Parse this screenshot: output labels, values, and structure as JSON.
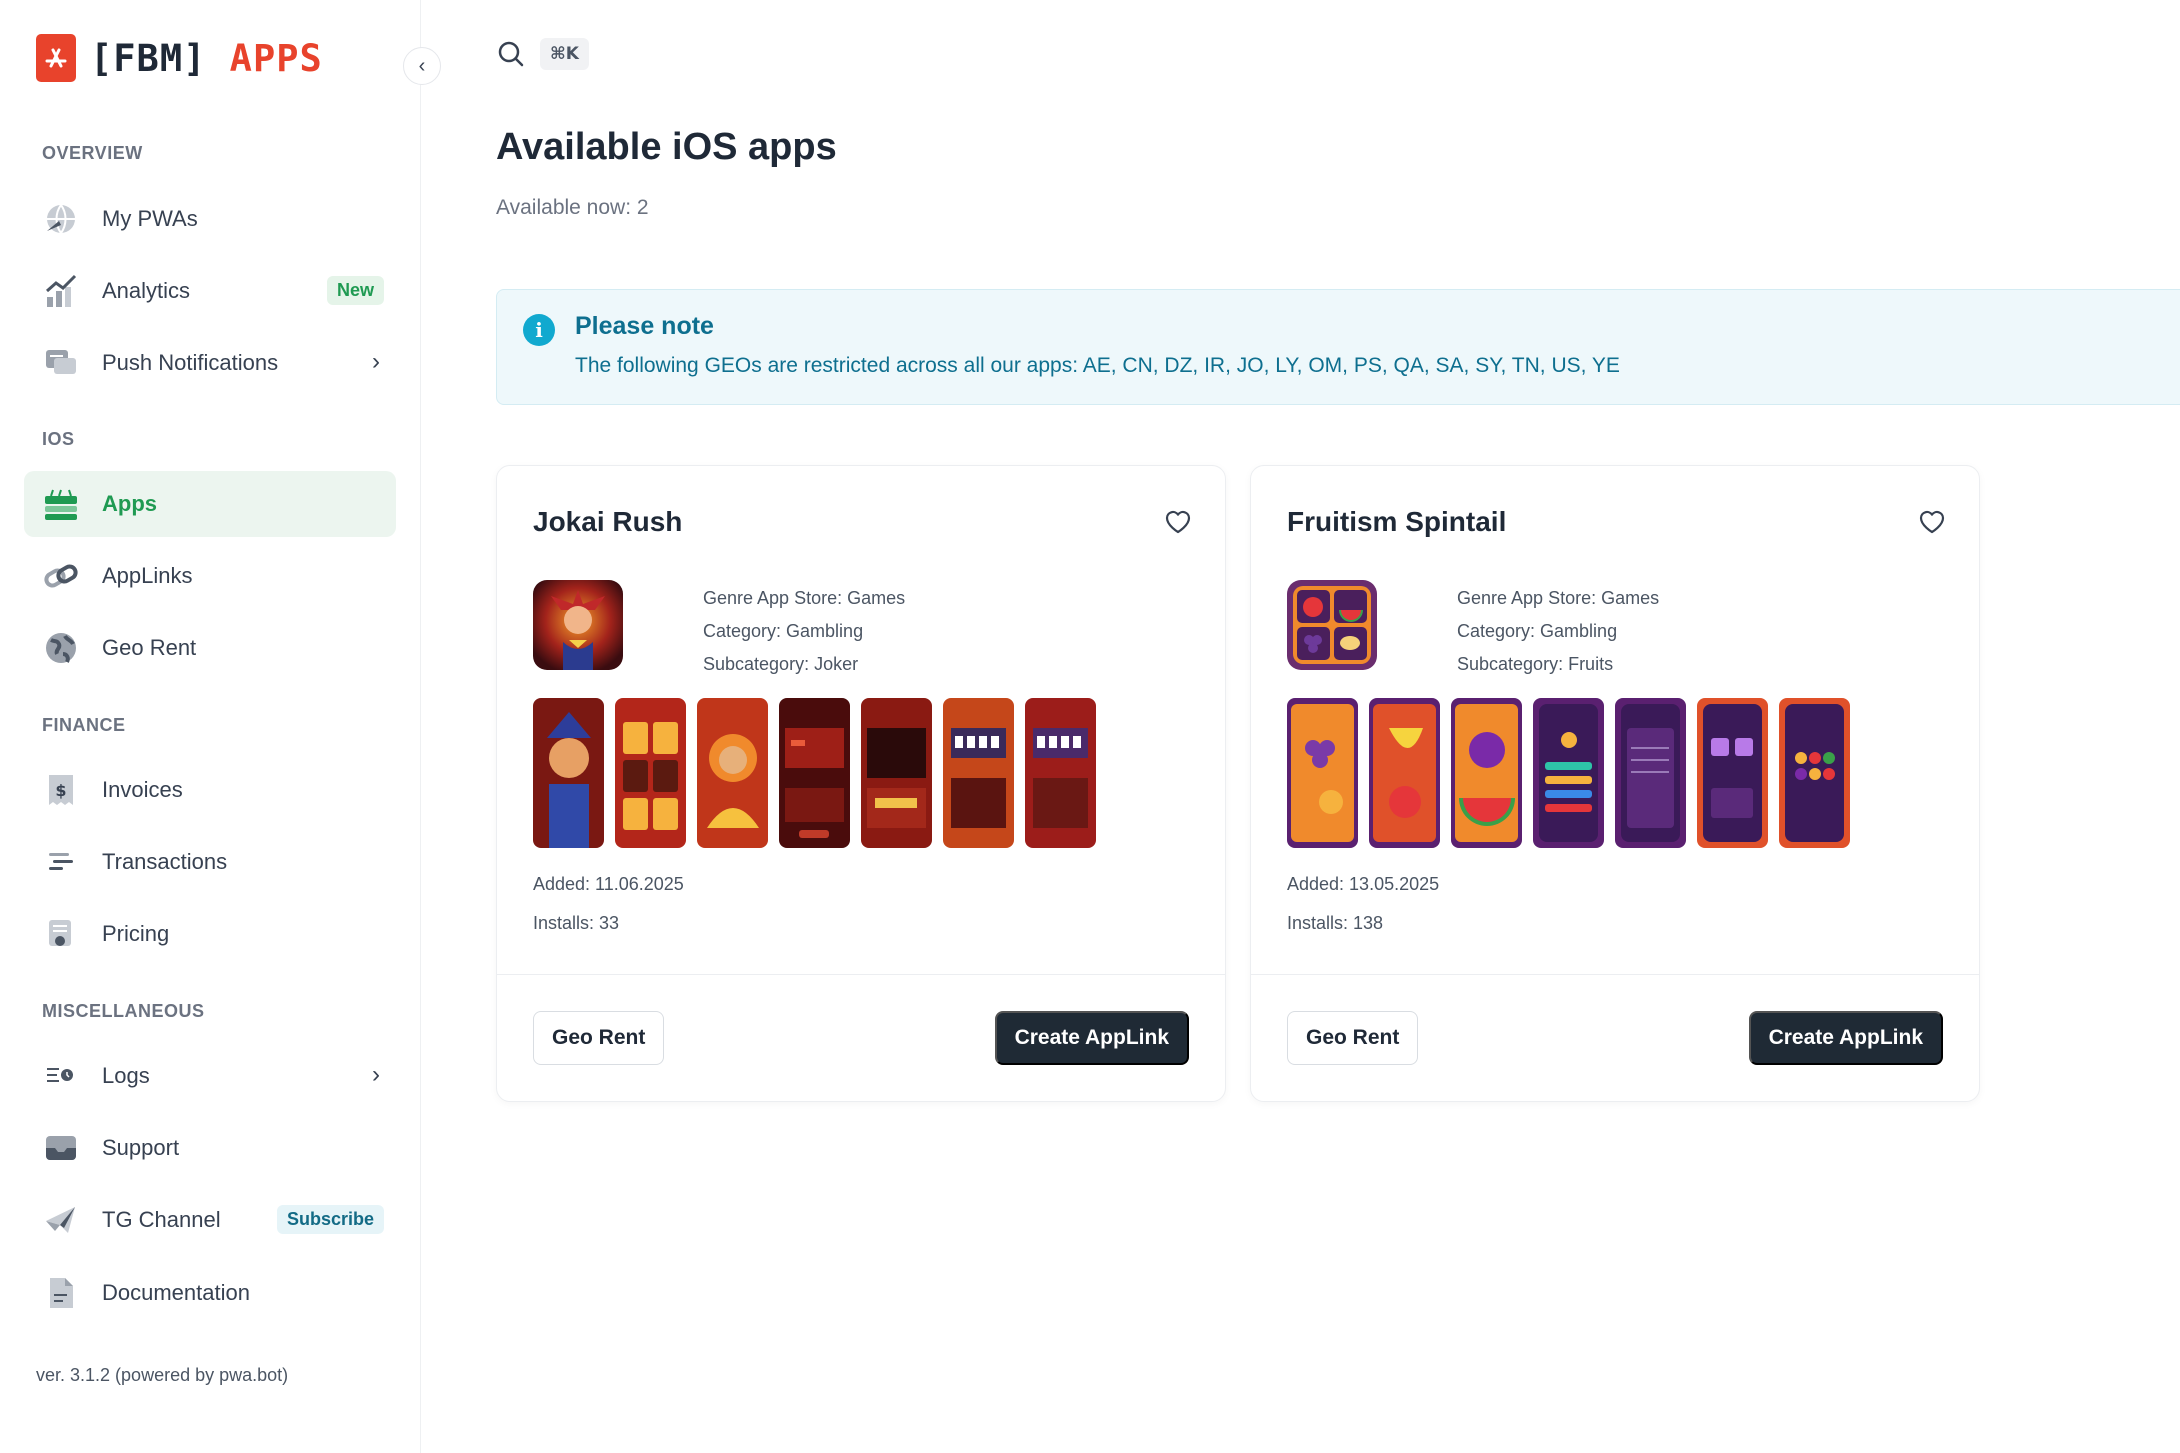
{
  "logo": {
    "bracket_text": "[FBM]",
    "apps_text": "APPS"
  },
  "sidebar": {
    "sections": {
      "overview": "OVERVIEW",
      "ios": "IOS",
      "finance": "FINANCE",
      "misc": "MISCELLANEOUS"
    },
    "items": {
      "my_pwas": "My PWAs",
      "analytics": "Analytics",
      "analytics_badge": "New",
      "push": "Push Notifications",
      "apps": "Apps",
      "applinks": "AppLinks",
      "geo_rent": "Geo Rent",
      "invoices": "Invoices",
      "transactions": "Transactions",
      "pricing": "Pricing",
      "logs": "Logs",
      "support": "Support",
      "tg": "TG Channel",
      "tg_badge": "Subscribe",
      "docs": "Documentation"
    },
    "version": "ver. 3.1.2 (powered by pwa.bot)"
  },
  "search": {
    "shortcut": "⌘K"
  },
  "main": {
    "title": "Available iOS apps",
    "subtitle": "Available now: 2",
    "note": {
      "title": "Please note",
      "text": "The following GEOs are restricted across all our apps: AE, CN, DZ, IR, JO, LY, OM, PS, QA, SA, SY, TN, US, YE"
    },
    "cards": [
      {
        "title": "Jokai Rush",
        "genre": "Genre App Store: Games",
        "category": "Category: Gambling",
        "subcategory": "Subcategory: Joker",
        "added": "Added: 11.06.2025",
        "installs": "Installs: 33",
        "geo_btn": "Geo Rent",
        "create_btn": "Create AppLink"
      },
      {
        "title": "Fruitism Spintail",
        "genre": "Genre App Store: Games",
        "category": "Category: Gambling",
        "subcategory": "Subcategory: Fruits",
        "added": "Added: 13.05.2025",
        "installs": "Installs: 138",
        "geo_btn": "Geo Rent",
        "create_btn": "Create AppLink"
      }
    ]
  },
  "colors": {
    "brand": "#e8432c",
    "active": "#1f9a52",
    "note": "#0e6f8f",
    "dark_button": "#1f2a35"
  }
}
